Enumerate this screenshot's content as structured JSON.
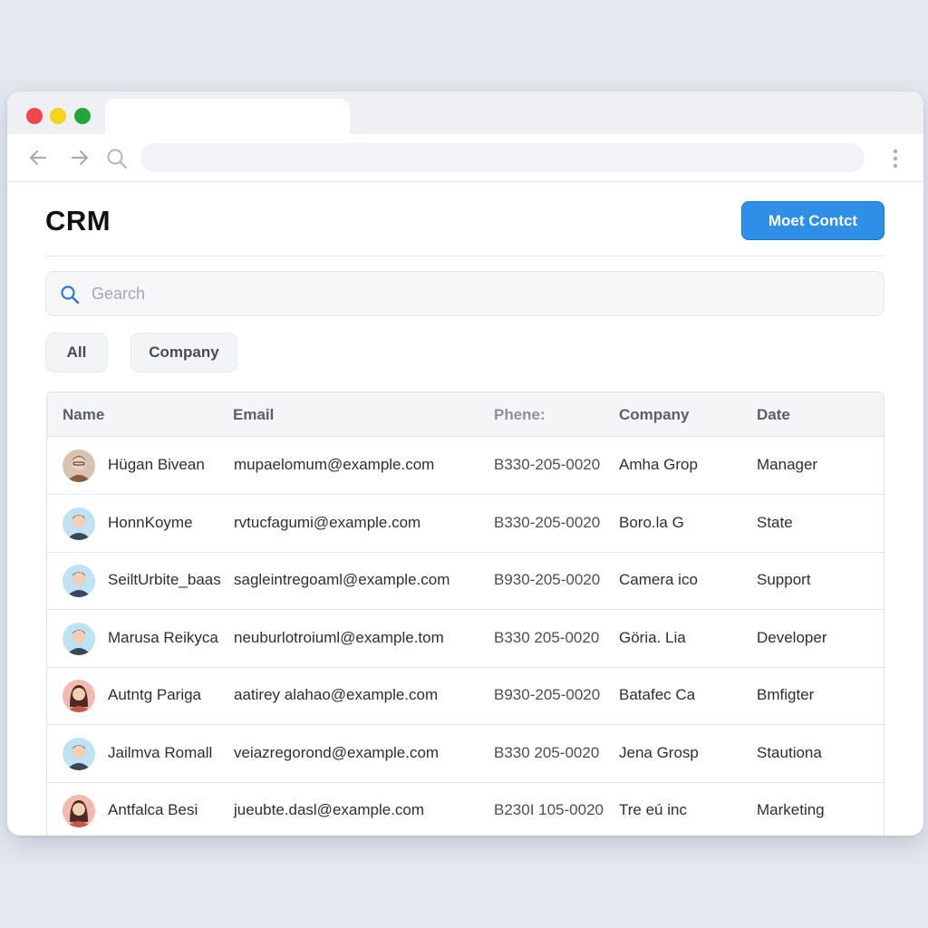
{
  "app": {
    "title": "CRM",
    "primary_button": "Moet Contct"
  },
  "search": {
    "placeholder": "Gearch"
  },
  "filters": [
    {
      "label": "All"
    },
    {
      "label": "Company"
    }
  ],
  "table": {
    "headers": {
      "name": "Name",
      "email": "Email",
      "phone": "Phene:",
      "company": "Company",
      "date": "Date"
    },
    "rows": [
      {
        "name": "Hügan Bivean",
        "email": "mupaelomum@example.com",
        "phone": "B330-205-0020",
        "company": "Amha Grop",
        "date": "Manager",
        "avatar": "avatar-brown"
      },
      {
        "name": "HonnKoyme",
        "email": "rvtucfagumi@example.com",
        "phone": "B330-205-0020",
        "company": "Boro.la G",
        "date": "State",
        "avatar": "avatar-blue"
      },
      {
        "name": "SeiltUrbite_baas",
        "email": "sagleintregoaml@example.com",
        "phone": "B930-205-0020",
        "company": "Camera ico",
        "date": "Support",
        "avatar": "avatar-blue"
      },
      {
        "name": "Marusa Reikyca",
        "email": "neuburlotroiuml@example.tom",
        "phone": "B330 205-0020",
        "company": "Göria. Lia",
        "date": "Developer",
        "avatar": "avatar-blue"
      },
      {
        "name": "Autntg Pariga",
        "email": "aatirey alahao@example.com",
        "phone": "B930-205-0020",
        "company": "Batafec Ca",
        "date": "Bmfigter",
        "avatar": "avatar-red"
      },
      {
        "name": "Jailmva Romall",
        "email": "veiazregorond@example.com",
        "phone": "B330 205-0020",
        "company": "Jena Grosp",
        "date": "Stautiona",
        "avatar": "avatar-blue"
      },
      {
        "name": "Antfalca Besi",
        "email": "jueubte.dasl@example.com",
        "phone": "B230I 105-0020",
        "company": "Tre eú inc",
        "date": "Marketing",
        "avatar": "avatar-red"
      }
    ]
  },
  "colors": {
    "accent": "#2f8ee5",
    "window_bg": "#ffffff",
    "page_bg": "#e4e8ef"
  },
  "icons": {
    "back": "arrow-left-icon",
    "forward": "arrow-right-icon",
    "search": "search-icon",
    "menu": "more-vertical-icon"
  }
}
